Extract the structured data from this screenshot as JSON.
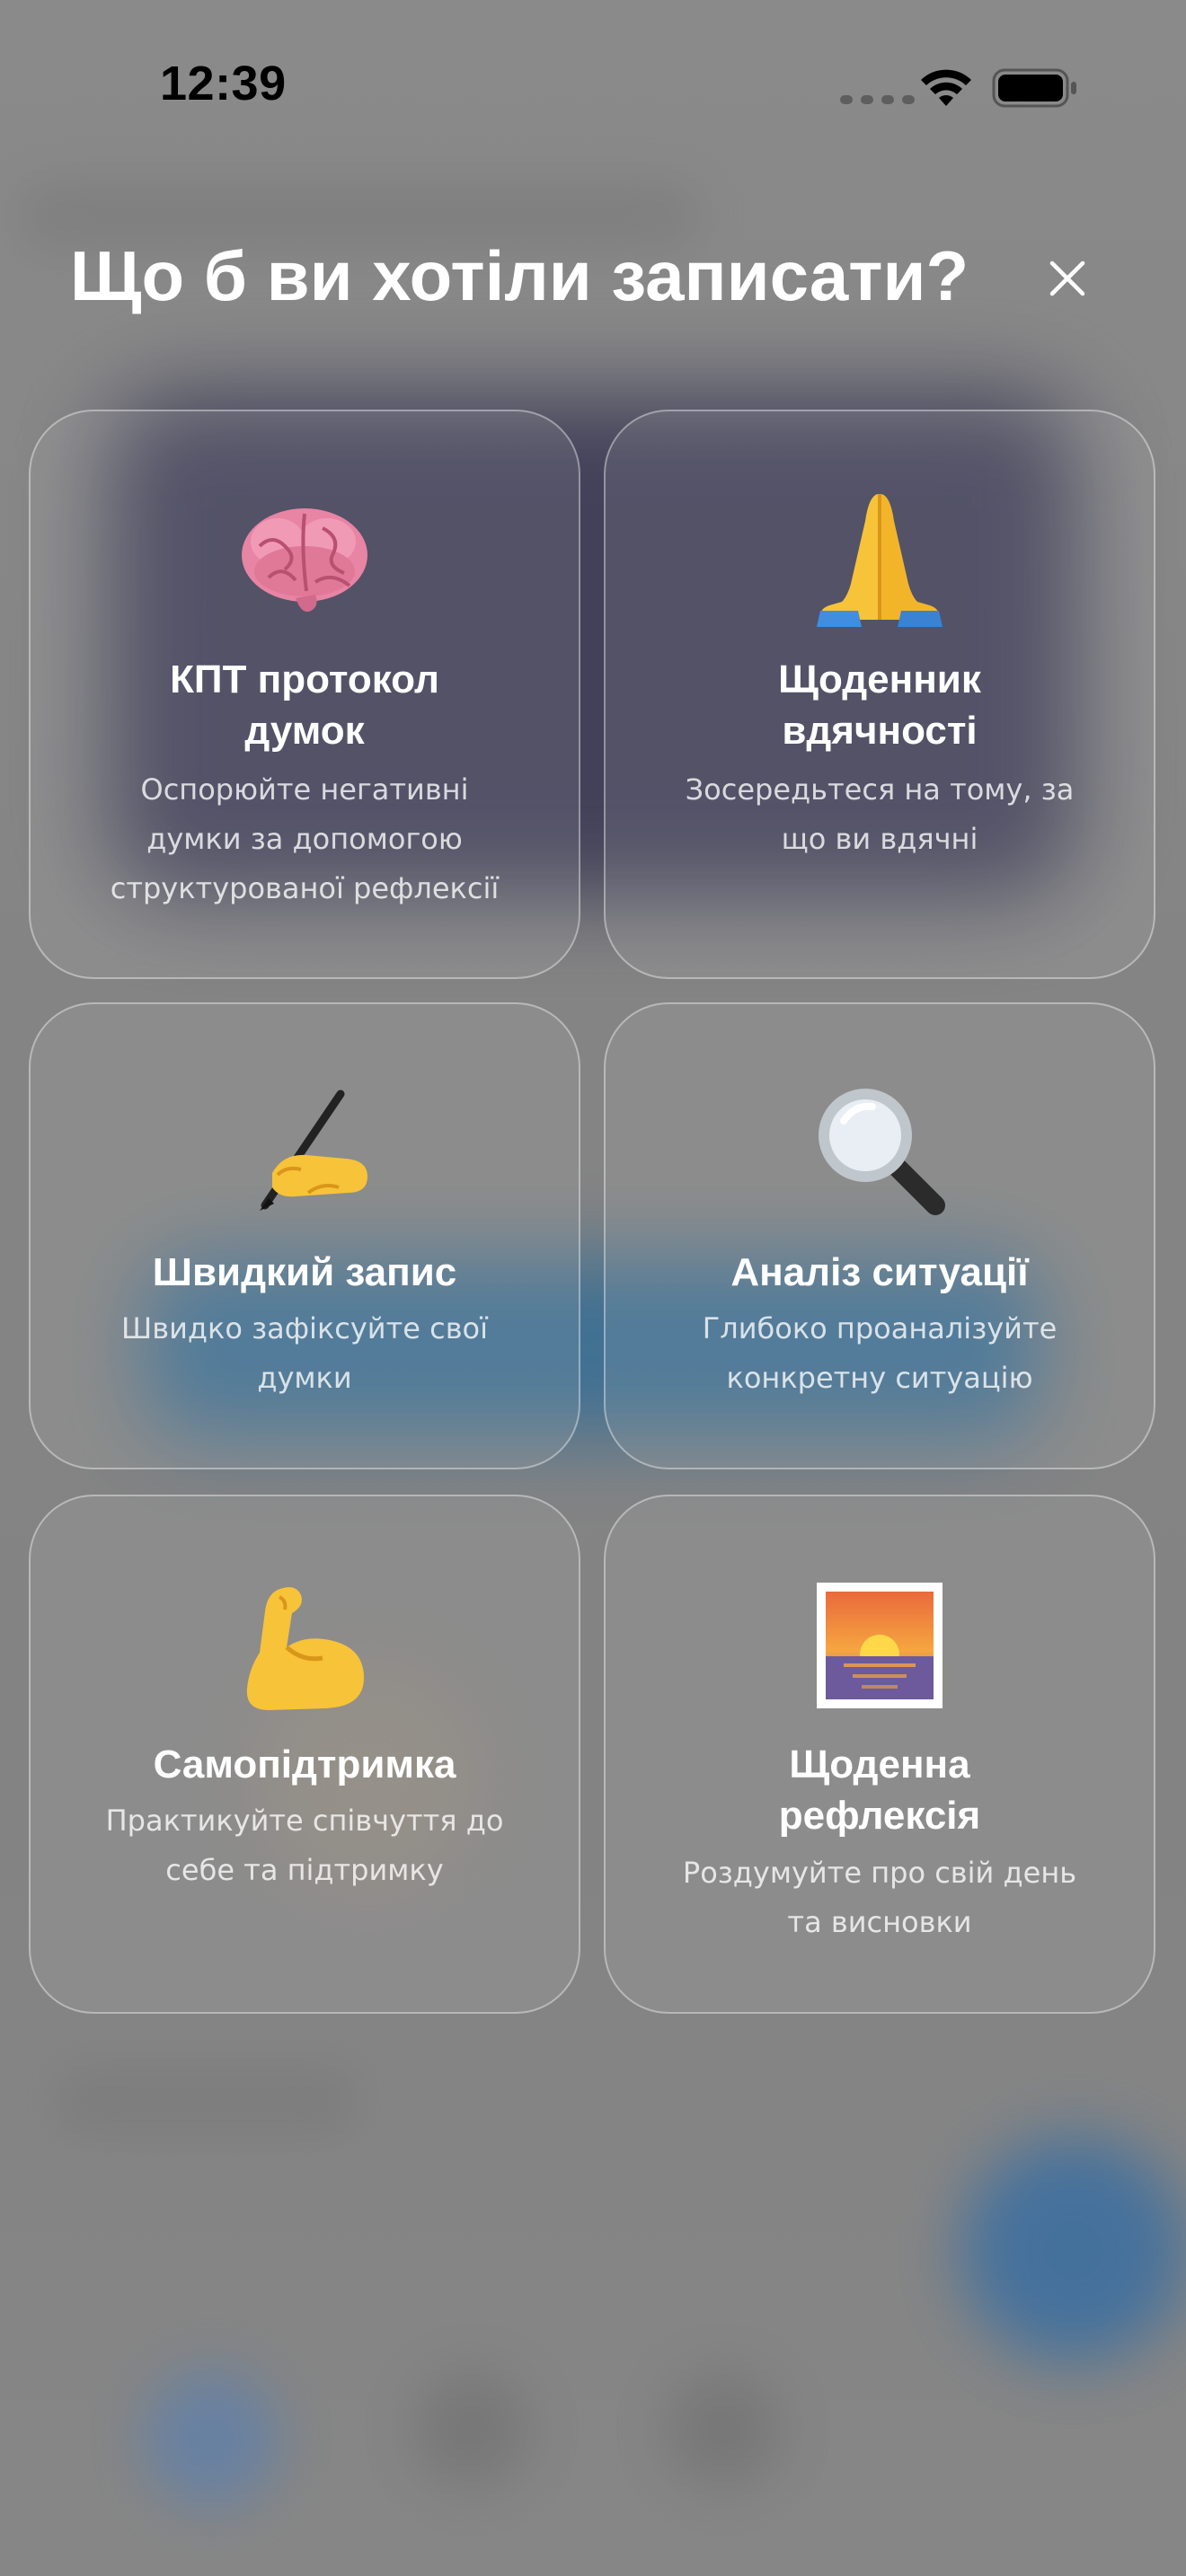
{
  "status_bar": {
    "time": "12:39"
  },
  "header": {
    "title": "Що б ви хотіли записати?",
    "close_icon": "close-icon"
  },
  "cards": [
    {
      "title_lines": [
        "КПТ протокол",
        "думок"
      ],
      "description_lines": [
        "Оспорюйте негативні",
        "думки за допомогою",
        "структурованої рефлексії"
      ],
      "icon": "brain-emoji-icon"
    },
    {
      "title_lines": [
        "Щоденник",
        "вдячності"
      ],
      "description_lines": [
        "Зосередьтеся на тому, за",
        "що ви вдячні"
      ],
      "icon": "praying-hands-emoji-icon"
    },
    {
      "title_lines": [
        "Швидкий запис"
      ],
      "description_lines": [
        "Швидко зафіксуйте свої",
        "думки"
      ],
      "icon": "writing-hand-emoji-icon"
    },
    {
      "title_lines": [
        "Аналіз ситуації"
      ],
      "description_lines": [
        "Глибоко проаналізуйте",
        "конкретну ситуацію"
      ],
      "icon": "magnifying-glass-emoji-icon"
    },
    {
      "title_lines": [
        "Самопідтримка"
      ],
      "description_lines": [
        "Практикуйте співчуття до",
        "себе та підтримку"
      ],
      "icon": "flexed-biceps-emoji-icon"
    },
    {
      "title_lines": [
        "Щоденна",
        "рефлексія"
      ],
      "description_lines": [
        "Роздумуйте про свій день",
        "та висновки"
      ],
      "icon": "sunrise-emoji-icon"
    }
  ],
  "colors": {
    "overlay_bg": "#858585",
    "card_border": "#c8c8c8",
    "text_primary": "#ffffff"
  }
}
